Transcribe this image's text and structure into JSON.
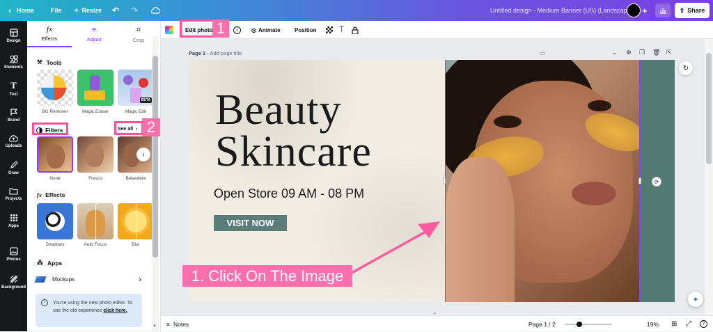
{
  "topbar": {
    "home": "Home",
    "file": "File",
    "resize": "Resize",
    "design_title": "Untitled design - Medium Banner (US) (Landscape)",
    "share": "Share"
  },
  "rail": {
    "items": [
      {
        "label": "Design",
        "icon": "design-icon"
      },
      {
        "label": "Elements",
        "icon": "elements-icon"
      },
      {
        "label": "Text",
        "icon": "text-icon"
      },
      {
        "label": "Brand",
        "icon": "brand-icon"
      },
      {
        "label": "Uploads",
        "icon": "uploads-icon"
      },
      {
        "label": "Draw",
        "icon": "draw-icon"
      },
      {
        "label": "Projects",
        "icon": "projects-icon"
      },
      {
        "label": "Apps",
        "icon": "apps-icon"
      },
      {
        "label": "Photos",
        "icon": "photos-icon"
      },
      {
        "label": "Background",
        "icon": "background-icon"
      }
    ]
  },
  "panel": {
    "tabs": [
      {
        "label": "Effects",
        "icon": "fx-icon",
        "glyph": "fx"
      },
      {
        "label": "Adjust",
        "icon": "sliders-icon",
        "glyph": "≡"
      },
      {
        "label": "Crop",
        "icon": "crop-icon",
        "glyph": "⌗"
      }
    ],
    "tools_title": "Tools",
    "tools": [
      {
        "label": "BG Remover"
      },
      {
        "label": "Magic Eraser"
      },
      {
        "label": "Magic Edit",
        "badge": "BETA"
      }
    ],
    "filters_title": "Filters",
    "see_all": "See all",
    "filters": [
      {
        "label": "None"
      },
      {
        "label": "Fresco"
      },
      {
        "label": "Belvedere"
      }
    ],
    "effects_title": "Effects",
    "effects": [
      {
        "label": "Shadows"
      },
      {
        "label": "Auto Focus"
      },
      {
        "label": "Blur"
      }
    ],
    "apps_title": "Apps",
    "apps": [
      {
        "label": "Mockups"
      }
    ],
    "notice_text": "You're using the new photo editor. To use the old experience",
    "notice_link": "click here."
  },
  "contextbar": {
    "edit_photo": "Edit photo",
    "animate": "Animate",
    "position": "Position"
  },
  "canvas": {
    "page_label": "Page 1",
    "page_title_placeholder": "- Add page title"
  },
  "design": {
    "title_line1": "Beauty",
    "title_line2": "Skincare",
    "hours": "Open Store 09 AM - 08 PM",
    "cta": "VISIT NOW"
  },
  "annotation": {
    "step1": "1",
    "step2": "2",
    "instruction": "1. Click On The Image"
  },
  "bottombar": {
    "notes": "Notes",
    "page_indicator": "Page 1 / 2",
    "zoom": "19%",
    "zoom_fraction": 0.19
  },
  "colors": {
    "accent": "#8b3dff",
    "callout": "#ff4f9a",
    "design_bg": "#f1ede4",
    "design_teal": "#527a72",
    "cta_bg": "#5b7d78"
  }
}
